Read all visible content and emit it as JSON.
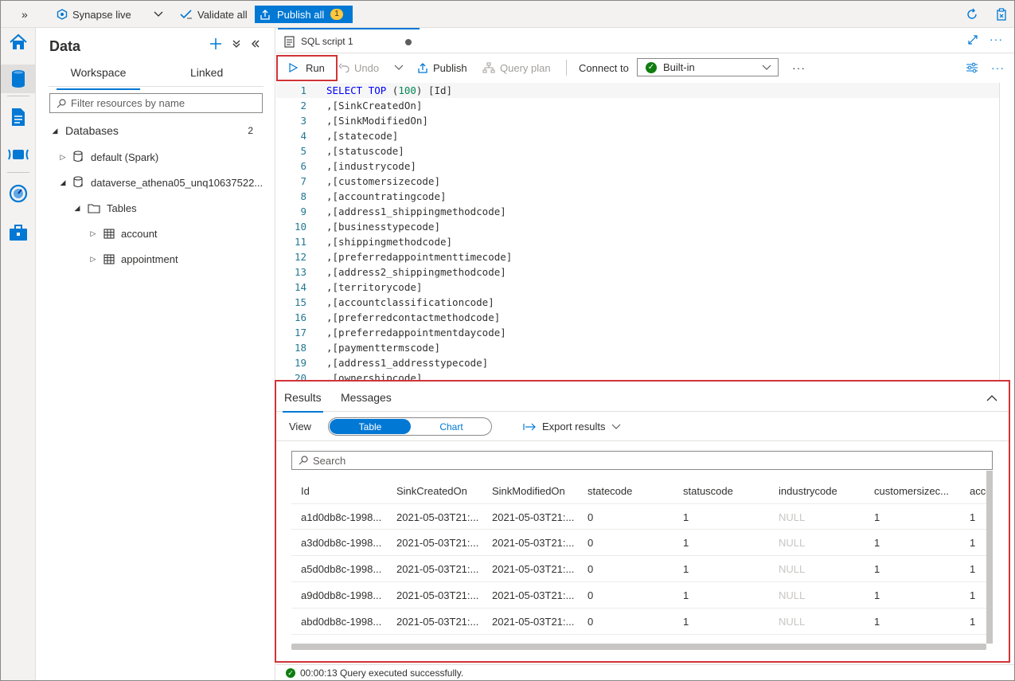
{
  "topbar": {
    "workspace_label": "Synapse live",
    "validate_label": "Validate all",
    "publish_label": "Publish all",
    "publish_count": "1",
    "expand_glyph": "»"
  },
  "rail": {
    "items": [
      "home-icon",
      "data-icon",
      "develop-icon",
      "integrate-icon",
      "monitor-icon",
      "manage-icon"
    ]
  },
  "data_pane": {
    "title": "Data",
    "tabs": [
      "Workspace",
      "Linked"
    ],
    "filter_placeholder": "Filter resources by name",
    "databases_label": "Databases",
    "databases_count": "2",
    "db1": "default (Spark)",
    "db2": "dataverse_athena05_unq10637522...",
    "tables_label": "Tables",
    "table1": "account",
    "table2": "appointment"
  },
  "editor": {
    "tab_title": "SQL script 1",
    "toolbar": {
      "run": "Run",
      "undo": "Undo",
      "publish": "Publish",
      "query_plan": "Query plan",
      "connect_to": "Connect to",
      "pool": "Built-in",
      "more": "···"
    },
    "lines": [
      {
        "n": "1",
        "kw": "SELECT TOP",
        "num": "100",
        "rest": " [Id]"
      },
      {
        "n": "2",
        "t": ",[SinkCreatedOn]"
      },
      {
        "n": "3",
        "t": ",[SinkModifiedOn]"
      },
      {
        "n": "4",
        "t": ",[statecode]"
      },
      {
        "n": "5",
        "t": ",[statuscode]"
      },
      {
        "n": "6",
        "t": ",[industrycode]"
      },
      {
        "n": "7",
        "t": ",[customersizecode]"
      },
      {
        "n": "8",
        "t": ",[accountratingcode]"
      },
      {
        "n": "9",
        "t": ",[address1_shippingmethodcode]"
      },
      {
        "n": "10",
        "t": ",[businesstypecode]"
      },
      {
        "n": "11",
        "t": ",[shippingmethodcode]"
      },
      {
        "n": "12",
        "t": ",[preferredappointmenttimecode]"
      },
      {
        "n": "13",
        "t": ",[address2_shippingmethodcode]"
      },
      {
        "n": "14",
        "t": ",[territorycode]"
      },
      {
        "n": "15",
        "t": ",[accountclassificationcode]"
      },
      {
        "n": "16",
        "t": ",[preferredcontactmethodcode]"
      },
      {
        "n": "17",
        "t": ",[preferredappointmentdaycode]"
      },
      {
        "n": "18",
        "t": ",[paymenttermscode]"
      },
      {
        "n": "19",
        "t": ",[address1_addresstypecode]"
      },
      {
        "n": "20",
        "t": ",[ownershipcode]"
      }
    ]
  },
  "results": {
    "tabs": [
      "Results",
      "Messages"
    ],
    "view_label": "View",
    "view_options": [
      "Table",
      "Chart"
    ],
    "export_label": "Export results",
    "search_placeholder": "Search",
    "columns": [
      "Id",
      "SinkCreatedOn",
      "SinkModifiedOn",
      "statecode",
      "statuscode",
      "industrycode",
      "customersizec...",
      "acco"
    ],
    "rows": [
      [
        "a1d0db8c-1998...",
        "2021-05-03T21:...",
        "2021-05-03T21:...",
        "0",
        "1",
        "NULL",
        "1",
        "1"
      ],
      [
        "a3d0db8c-1998...",
        "2021-05-03T21:...",
        "2021-05-03T21:...",
        "0",
        "1",
        "NULL",
        "1",
        "1"
      ],
      [
        "a5d0db8c-1998...",
        "2021-05-03T21:...",
        "2021-05-03T21:...",
        "0",
        "1",
        "NULL",
        "1",
        "1"
      ],
      [
        "a9d0db8c-1998...",
        "2021-05-03T21:...",
        "2021-05-03T21:...",
        "0",
        "1",
        "NULL",
        "1",
        "1"
      ],
      [
        "abd0db8c-1998...",
        "2021-05-03T21:...",
        "2021-05-03T21:...",
        "0",
        "1",
        "NULL",
        "1",
        "1"
      ]
    ]
  },
  "status": {
    "message": "00:00:13 Query executed successfully."
  },
  "colors": {
    "accent": "#0078d4",
    "highlight_border": "#d13438",
    "success": "#107c10"
  }
}
